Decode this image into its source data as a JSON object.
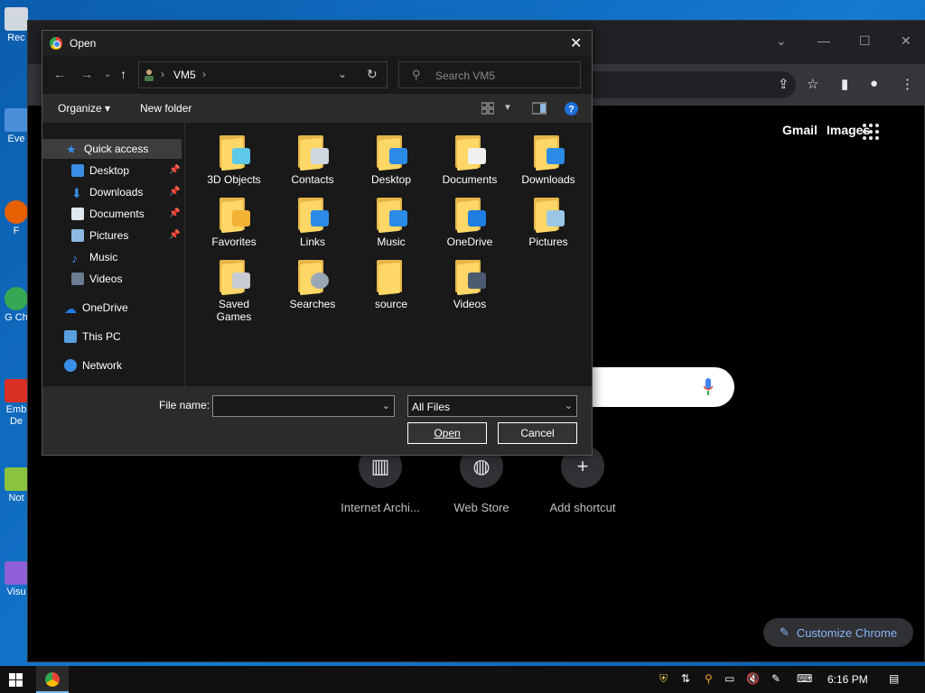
{
  "desktop": {
    "icons": [
      {
        "label": "Rec",
        "color": "#d0d7df"
      },
      {
        "label": "Eve",
        "color": "#4a90d9"
      },
      {
        "label": "F",
        "color": "#e66000"
      },
      {
        "label": "G Ch",
        "color": "#34a853"
      },
      {
        "label": "Emb De",
        "color": "#d93025"
      },
      {
        "label": "Not",
        "color": "#8ac43f"
      },
      {
        "label": "Visu",
        "color": "#8e5fd6"
      }
    ]
  },
  "chrome": {
    "links": {
      "gmail": "Gmail",
      "images": "Images"
    },
    "shortcuts": [
      {
        "label": "Internet Archi...",
        "icon": "archive-icon"
      },
      {
        "label": "Web Store",
        "icon": "web-store-icon"
      },
      {
        "label": "Add shortcut",
        "icon": "plus-icon"
      }
    ],
    "customize_label": "Customize Chrome"
  },
  "dialog": {
    "title": "Open",
    "close_glyph": "✕",
    "address": {
      "location": "VM5"
    },
    "search_placeholder": "Search VM5",
    "commands": {
      "organize": "Organize",
      "new_folder": "New folder"
    },
    "nav_pane": {
      "quick_access": "Quick access",
      "pinned": [
        {
          "label": "Desktop",
          "color": "#3a8ee6",
          "pinned": true
        },
        {
          "label": "Downloads",
          "color": "#3a8ee6",
          "pinned": true
        },
        {
          "label": "Documents",
          "color": "#dfe6ee",
          "pinned": true
        },
        {
          "label": "Pictures",
          "color": "#8fb8e0",
          "pinned": true
        },
        {
          "label": "Music",
          "color": "#3a8ee6",
          "pinned": false
        },
        {
          "label": "Videos",
          "color": "#6b7c93",
          "pinned": false
        }
      ],
      "onedrive": "OneDrive",
      "this_pc": "This PC",
      "network": "Network"
    },
    "folders": [
      {
        "label": "3D Objects",
        "badge": "#5ec8e8"
      },
      {
        "label": "Contacts",
        "badge": "#cfd8e0"
      },
      {
        "label": "Desktop",
        "badge": "#2b8ae6"
      },
      {
        "label": "Documents",
        "badge": "#f0f0f0"
      },
      {
        "label": "Downloads",
        "badge": "#2b8ae6"
      },
      {
        "label": "Favorites",
        "badge": "#f2b233"
      },
      {
        "label": "Links",
        "badge": "#2b8ae6"
      },
      {
        "label": "Music",
        "badge": "#2b8ae6"
      },
      {
        "label": "OneDrive",
        "badge": "#1e7de0"
      },
      {
        "label": "Pictures",
        "badge": "#9cc6e6"
      },
      {
        "label": "Saved Games",
        "badge": "#c8ccd2"
      },
      {
        "label": "Searches",
        "badge": "#9aa8b6"
      },
      {
        "label": "source",
        "badge": "#ffd766"
      },
      {
        "label": "Videos",
        "badge": "#4b5b70"
      }
    ],
    "file_name_label": "File name:",
    "file_name_value": "",
    "file_type": "All Files",
    "open_label": "Open",
    "cancel_label": "Cancel"
  },
  "taskbar": {
    "time": "6:16 PM"
  }
}
